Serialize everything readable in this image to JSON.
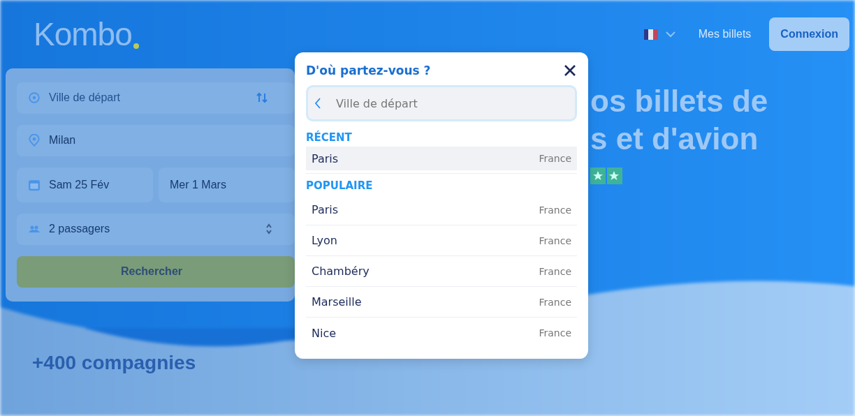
{
  "header": {
    "logo": "Kombo",
    "nav_link": "Mes billets",
    "login_button": "Connexion"
  },
  "search_form": {
    "fields": [
      {
        "kind": "origin",
        "placeholder": "Ville de départ"
      },
      {
        "kind": "destination",
        "value": "Milan"
      },
      {
        "kind": "date",
        "value": "Sam 25 Fév"
      },
      {
        "kind": "return_date",
        "value": "Mer 1 Mars"
      },
      {
        "kind": "passengers",
        "value": "2 passagers"
      }
    ],
    "search_button": "Rechercher"
  },
  "hero": {
    "title_lines": [
      "os billets de",
      "s et d'avion"
    ]
  },
  "companies_heading": "+400 compagnies",
  "modal": {
    "title": "D'où partez-vous ?",
    "search": {
      "placeholder": "Ville de départ"
    },
    "sections": [
      {
        "heading": "RÉCENT",
        "items": [
          {
            "city": "Paris",
            "country": "France",
            "selected": true
          }
        ]
      },
      {
        "heading": "POPULAIRE",
        "items": [
          {
            "city": "Paris",
            "country": "France",
            "selected": false
          },
          {
            "city": "Lyon",
            "country": "France",
            "selected": false
          },
          {
            "city": "Chambéry",
            "country": "France",
            "selected": false
          },
          {
            "city": "Marseille",
            "country": "France",
            "selected": false
          },
          {
            "city": "Nice",
            "country": "France",
            "selected": false
          }
        ]
      }
    ]
  }
}
